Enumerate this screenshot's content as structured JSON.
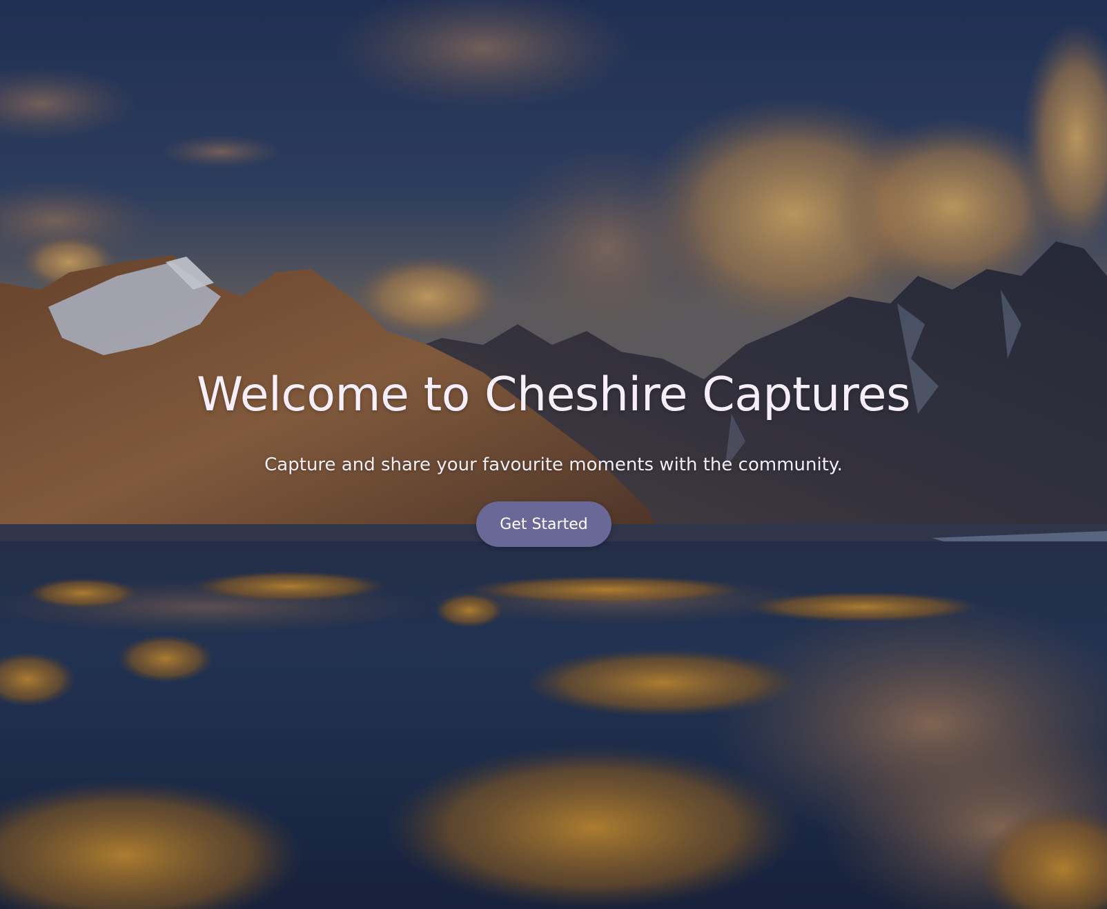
{
  "hero": {
    "title": "Welcome to Cheshire Captures",
    "subtitle": "Capture and share your favourite moments with the community.",
    "cta_label": "Get Started",
    "background": "mountain-landscape-photo"
  },
  "colors": {
    "title_text": "#f6eef8",
    "button_bg": "#6a6896",
    "button_text": "#ffffff"
  }
}
